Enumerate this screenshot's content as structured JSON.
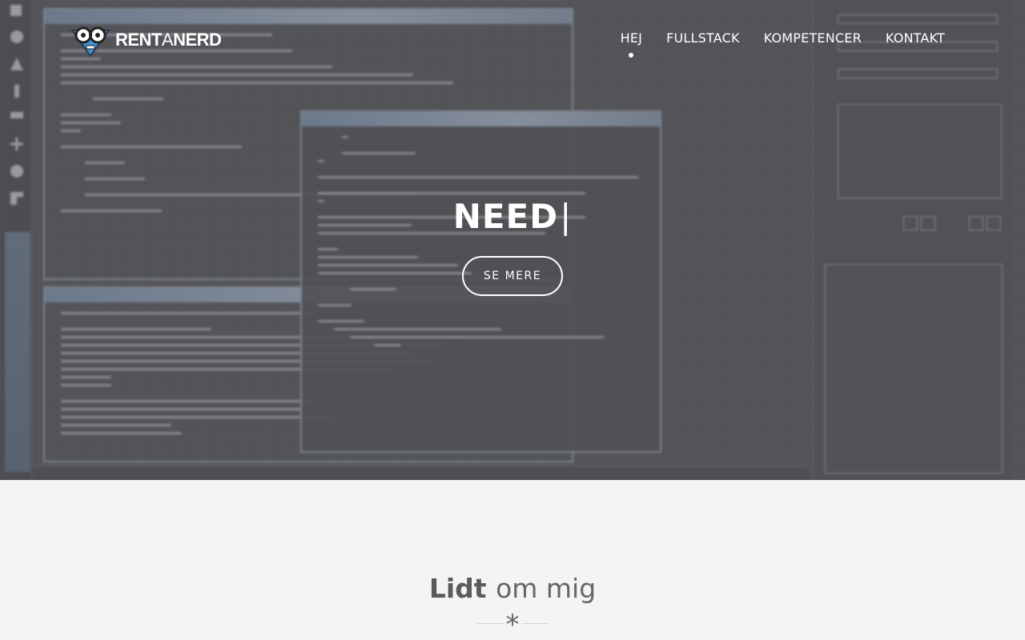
{
  "brand": {
    "name_bold_1": "RENT",
    "name_thin": "A",
    "name_bold_2": "NERD"
  },
  "nav": {
    "items": [
      {
        "label": "HEJ",
        "active": true
      },
      {
        "label": "FULLSTACK",
        "active": false
      },
      {
        "label": "KOMPETENCER",
        "active": false
      },
      {
        "label": "KONTAKT",
        "active": false
      }
    ]
  },
  "hero": {
    "title": "NEED",
    "cursor": "|",
    "cta_label": "SE MERE"
  },
  "about": {
    "title_bold": "Lidt",
    "title_light": "om mig",
    "divider_symbol": "*"
  },
  "colors": {
    "hero_bg": "#5a5b5f",
    "page_bg": "#f4f4f4",
    "text_light": "#ffffff",
    "heading_gray": "#5a5a5a",
    "logo_blue": "#3e8ed0"
  }
}
